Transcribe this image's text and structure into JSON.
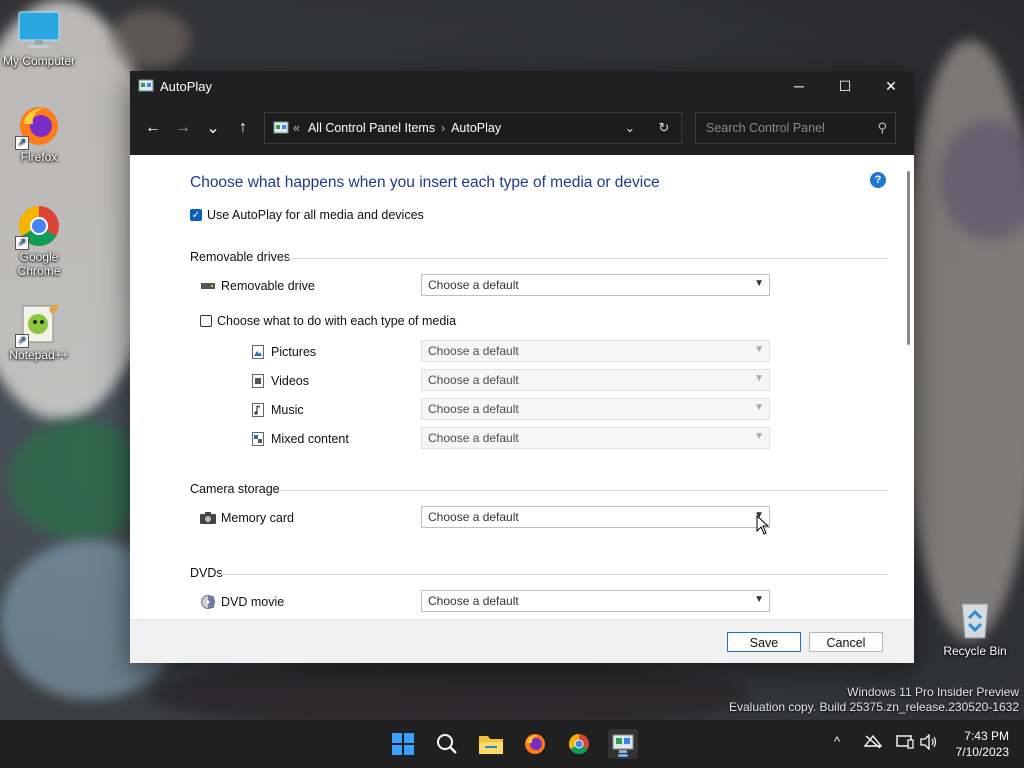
{
  "desktop": {
    "icons": [
      {
        "label": "My Computer",
        "icon": "monitor-icon"
      },
      {
        "label": "Firefox",
        "icon": "firefox-icon"
      },
      {
        "label": "Google Chrome",
        "icon": "chrome-icon"
      },
      {
        "label": "Notepad++",
        "icon": "notepadpp-icon"
      }
    ],
    "recycle_bin": "Recycle Bin",
    "watermark_line1": "Windows 11 Pro Insider Preview",
    "watermark_line2": "Evaluation copy. Build 25375.zn_release.230520-1632"
  },
  "window": {
    "title": "AutoPlay",
    "controls": {
      "minimize": "─",
      "maximize": "☐",
      "close": "✕"
    },
    "nav": {
      "back": "←",
      "forward": "→",
      "recent": "⌄",
      "up": "↑"
    },
    "address": {
      "overflow": "«",
      "crumbs": [
        "All Control Panel Items",
        "AutoPlay"
      ],
      "separator": "›",
      "dropdown": "⌄",
      "refresh": "↻"
    },
    "search": {
      "placeholder": "Search Control Panel"
    },
    "heading": "Choose what happens when you insert each type of media or device",
    "use_autoplay": {
      "label": "Use AutoPlay for all media and devices",
      "checked": true
    },
    "sections": {
      "removable": {
        "title": "Removable drives",
        "drive": {
          "label": "Removable drive",
          "value": "Choose a default"
        },
        "per_media": {
          "label": "Choose what to do with each type of media",
          "checked": false
        },
        "media": [
          {
            "label": "Pictures",
            "value": "Choose a default",
            "icon": "pictures-icon"
          },
          {
            "label": "Videos",
            "value": "Choose a default",
            "icon": "videos-icon"
          },
          {
            "label": "Music",
            "value": "Choose a default",
            "icon": "music-icon"
          },
          {
            "label": "Mixed content",
            "value": "Choose a default",
            "icon": "mixed-content-icon"
          }
        ]
      },
      "camera": {
        "title": "Camera storage",
        "memory_card": {
          "label": "Memory card",
          "value": "Choose a default"
        }
      },
      "dvds": {
        "title": "DVDs",
        "dvd_movie": {
          "label": "DVD movie",
          "value": "Choose a default"
        }
      }
    },
    "buttons": {
      "save": "Save",
      "cancel": "Cancel"
    },
    "help": "?"
  },
  "taskbar": {
    "apps": [
      "start-icon",
      "search-icon",
      "file-explorer-icon",
      "firefox-icon",
      "chrome-icon",
      "control-panel-icon"
    ],
    "tray": {
      "chevron": "^"
    },
    "time": "7:43 PM",
    "date": "7/10/2023"
  }
}
